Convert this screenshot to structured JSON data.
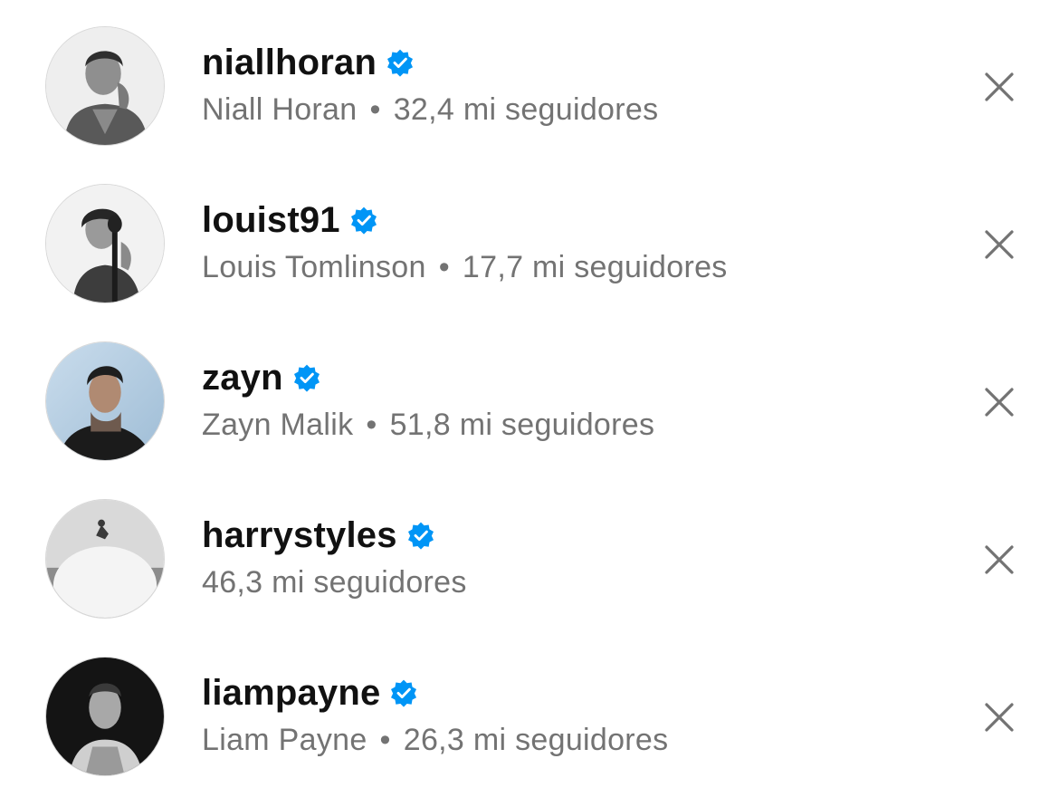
{
  "suggestions": [
    {
      "username": "niallhoran",
      "full_name": "Niall Horan",
      "separator": "•",
      "followers": "32,4 mi seguidores",
      "verified": true,
      "avatar_icon": "portrait-photo",
      "avatar_tone": "grayscale"
    },
    {
      "username": "louist91",
      "full_name": "Louis Tomlinson",
      "separator": "•",
      "followers": "17,7 mi seguidores",
      "verified": true,
      "avatar_icon": "portrait-photo",
      "avatar_tone": "grayscale"
    },
    {
      "username": "zayn",
      "full_name": "Zayn Malik",
      "separator": "•",
      "followers": "51,8 mi seguidores",
      "verified": true,
      "avatar_icon": "portrait-photo",
      "avatar_tone": "color"
    },
    {
      "username": "harrystyles",
      "full_name": "",
      "separator": "",
      "followers": "46,3 mi seguidores",
      "verified": true,
      "avatar_icon": "landscape-photo",
      "avatar_tone": "grayscale"
    },
    {
      "username": "liampayne",
      "full_name": "Liam Payne",
      "separator": "•",
      "followers": "26,3 mi seguidores",
      "verified": true,
      "avatar_icon": "portrait-photo",
      "avatar_tone": "grayscale"
    }
  ],
  "icons": {
    "verified": "verified-badge-icon",
    "dismiss": "close-icon"
  },
  "colors": {
    "verified": "#0095f6",
    "primary_text": "#111111",
    "secondary_text": "#737373",
    "close": "#737373"
  }
}
